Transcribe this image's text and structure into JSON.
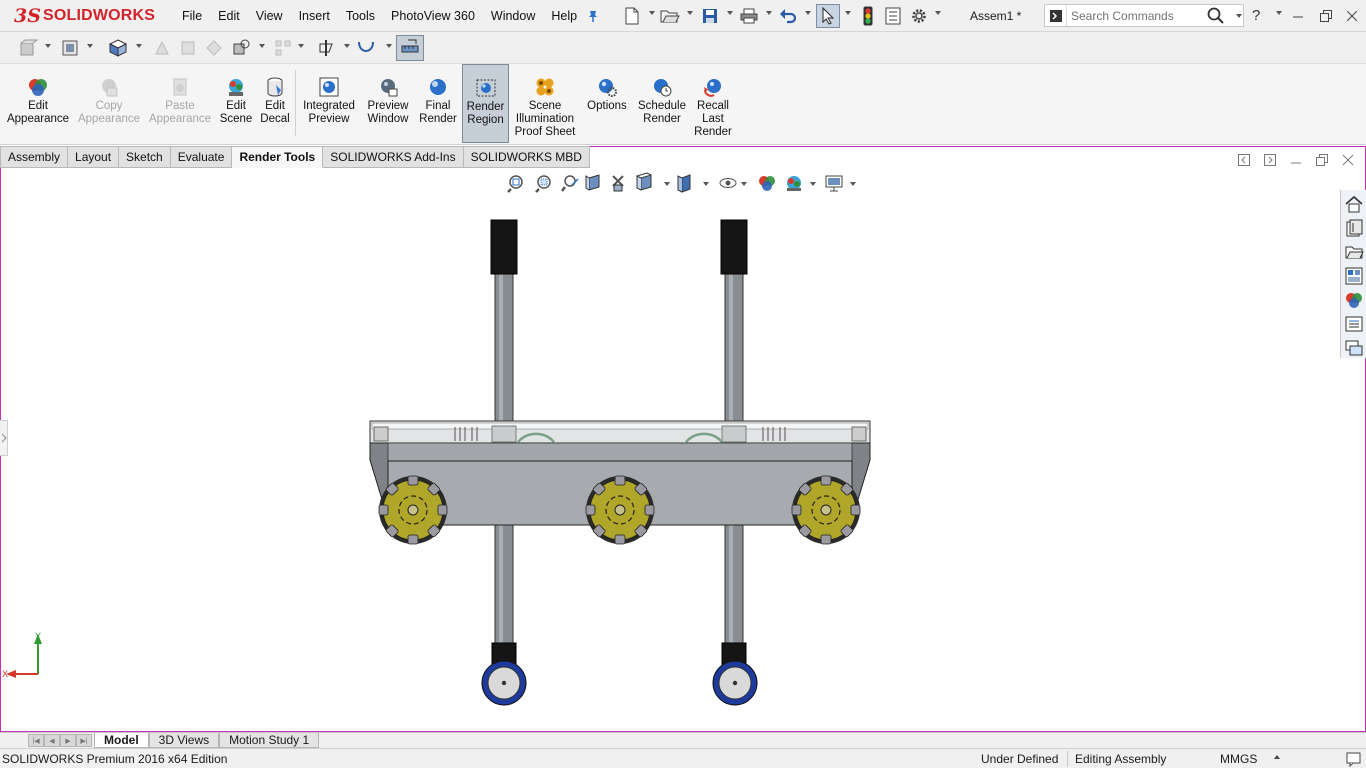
{
  "app": {
    "logo_prefix": "3S",
    "logo_text": "SOLIDWORKS",
    "document_title": "Assem1 *"
  },
  "menu": [
    "File",
    "Edit",
    "View",
    "Insert",
    "Tools",
    "PhotoView 360",
    "Window",
    "Help"
  ],
  "search": {
    "placeholder": "Search Commands"
  },
  "help_label": "?",
  "commands": [
    {
      "id": "edit-appearance",
      "label": "Edit\nAppearance",
      "enabled": true
    },
    {
      "id": "copy-appearance",
      "label": "Copy\nAppearance",
      "enabled": false
    },
    {
      "id": "paste-appearance",
      "label": "Paste\nAppearance",
      "enabled": false
    },
    {
      "id": "edit-scene",
      "label": "Edit\nScene",
      "enabled": true
    },
    {
      "id": "edit-decal",
      "label": "Edit\nDecal",
      "enabled": true
    },
    {
      "id": "integrated-preview",
      "label": "Integrated\nPreview",
      "enabled": true
    },
    {
      "id": "preview-window",
      "label": "Preview\nWindow",
      "enabled": true
    },
    {
      "id": "final-render",
      "label": "Final\nRender",
      "enabled": true
    },
    {
      "id": "render-region",
      "label": "Render\nRegion",
      "enabled": true,
      "active": true
    },
    {
      "id": "scene-illumination-proof-sheet",
      "label": "Scene\nIllumination\nProof Sheet",
      "enabled": true
    },
    {
      "id": "options",
      "label": "Options",
      "enabled": true
    },
    {
      "id": "schedule-render",
      "label": "Schedule\nRender",
      "enabled": true
    },
    {
      "id": "recall-last-render",
      "label": "Recall\nLast\nRender",
      "enabled": true
    }
  ],
  "tabs": [
    {
      "label": "Assembly",
      "active": false
    },
    {
      "label": "Layout",
      "active": false
    },
    {
      "label": "Sketch",
      "active": false
    },
    {
      "label": "Evaluate",
      "active": false
    },
    {
      "label": "Render Tools",
      "active": true
    },
    {
      "label": "SOLIDWORKS Add-Ins",
      "active": false
    },
    {
      "label": "SOLIDWORKS MBD",
      "active": false
    }
  ],
  "triad": {
    "y_label": "Y",
    "x_label": "X"
  },
  "bottom_tabs": [
    {
      "label": "Model",
      "active": true
    },
    {
      "label": "3D Views",
      "active": false
    },
    {
      "label": "Motion Study 1",
      "active": false
    }
  ],
  "status": {
    "edition": "SOLIDWORKS Premium 2016 x64 Edition",
    "definition": "Under Defined",
    "mode": "Editing Assembly",
    "units": "MMGS"
  },
  "colors": {
    "accent_red": "#d2232a",
    "viewport_border": "#c82fb8",
    "wheel_yellow": "#b0a629",
    "caster_blue": "#1d3a9c"
  }
}
